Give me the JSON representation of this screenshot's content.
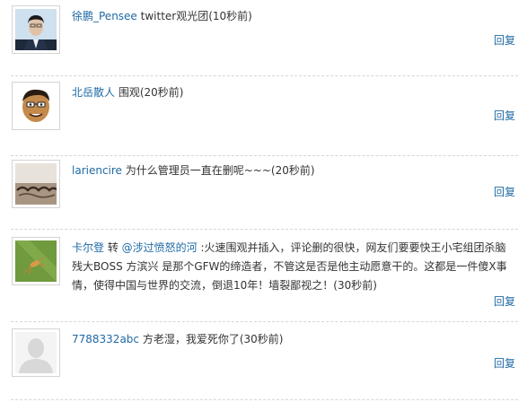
{
  "comments": [
    {
      "username": "徐鹏_Pensee",
      "text_before": " twitter观光团",
      "time": "(10秒前)",
      "reply_label": "回复",
      "avatar": "person-photo-avatar"
    },
    {
      "username": "北岳散人",
      "text_before": "  围观",
      "time": "(20秒前)",
      "reply_label": "回复",
      "avatar": "caricature-avatar"
    },
    {
      "username": "lariencire",
      "text_before": " 为什么管理员一直在删呢~~~",
      "time": "(20秒前)",
      "reply_label": "回复",
      "avatar": "text-photo-avatar"
    },
    {
      "username": "卡尔登",
      "text_before": " 转 ",
      "mention": "@涉过愤怒的河",
      "text_after": " :火速围观并插入，评论删的很快，网友们要要快王小宅组团杀脑残大BOSS 方滨兴 是那个GFW的缔造者，不管这是否是他主动愿意干的。这都是一件傻X事情，使得中国与世界的交流，倒退10年！墙裂鄙视之！",
      "time": "(30秒前)",
      "reply_label": "回复",
      "avatar": "insect-photo-avatar"
    },
    {
      "username": "7788332abc",
      "text_before": " 方老湿，我爱死你了",
      "time": "(30秒前)",
      "reply_label": "回复",
      "avatar": "default-silhouette-avatar"
    }
  ]
}
